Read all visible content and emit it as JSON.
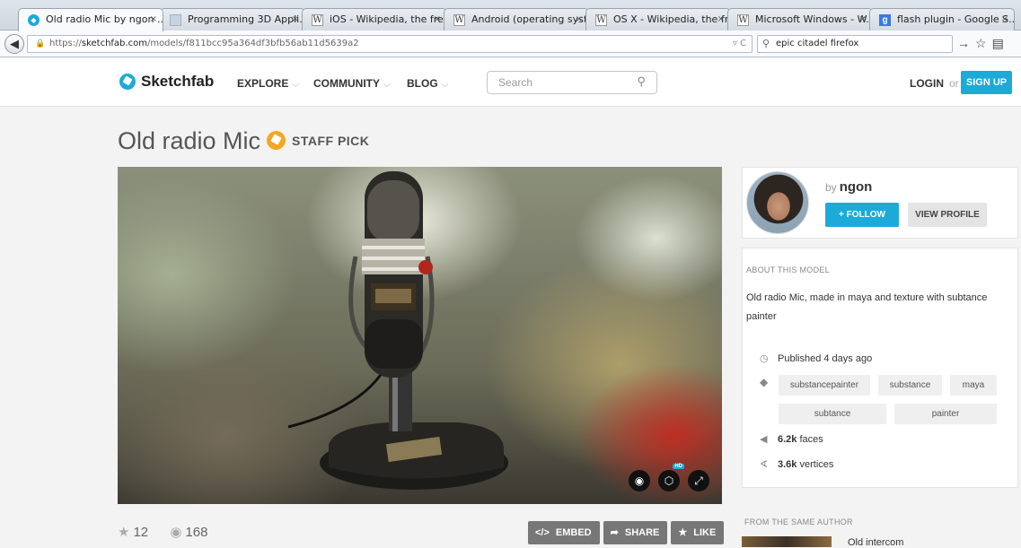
{
  "browser": {
    "tabs": [
      {
        "label": "Old radio Mic by ngon ...",
        "icon": "sketchfab-icon",
        "active": true
      },
      {
        "label": "Programming 3D Appli...",
        "icon": "page-icon",
        "active": false
      },
      {
        "label": "iOS - Wikipedia, the fre...",
        "icon": "wikipedia-icon",
        "active": false
      },
      {
        "label": "Android (operating syst...",
        "icon": "wikipedia-icon",
        "active": false
      },
      {
        "label": "OS X - Wikipedia, the fr...",
        "icon": "wikipedia-icon",
        "active": false
      },
      {
        "label": "Microsoft Windows - W...",
        "icon": "wikipedia-icon",
        "active": false
      },
      {
        "label": "flash plugin - Google S...",
        "icon": "google-icon",
        "active": false
      }
    ],
    "tab_close": "×",
    "wiki_glyph": "W",
    "google_glyph": "g",
    "url_prefix": "https://",
    "url_host": "sketchfab.com",
    "url_path": "/models/f811bcc95a364df3bfb56ab11d5639a2",
    "search_value": "epic citadel firefox",
    "url_controls": "▿ C"
  },
  "site": {
    "brand": "Sketchfab",
    "nav": [
      {
        "label": "EXPLORE"
      },
      {
        "label": "COMMUNITY"
      },
      {
        "label": "BLOG"
      }
    ],
    "search_placeholder": "Search",
    "login": "LOGIN",
    "or": "or",
    "signup": "SIGN UP"
  },
  "model": {
    "title": "Old radio Mic",
    "staff_pick": "STAFF PICK",
    "hd_badge": "HD",
    "likes": "12",
    "views": "168",
    "actions": {
      "embed": "EMBED",
      "share": "SHARE",
      "like": "LIKE"
    }
  },
  "author": {
    "by": "by",
    "name": "ngon",
    "follow": "+ FOLLOW",
    "view_profile": "VIEW PROFILE"
  },
  "about": {
    "title": "ABOUT THIS MODEL",
    "description": "Old radio Mic, made in maya and texture with subtance painter",
    "published": "Published 4 days ago",
    "tags": [
      "substancepainter",
      "substance",
      "maya",
      "subtance",
      "painter"
    ],
    "faces_value": "6.2k",
    "faces_label": "faces",
    "vertices_value": "3.6k",
    "vertices_label": "vertices"
  },
  "related": {
    "heading": "FROM THE SAME AUTHOR",
    "first_title": "Old intercom"
  }
}
